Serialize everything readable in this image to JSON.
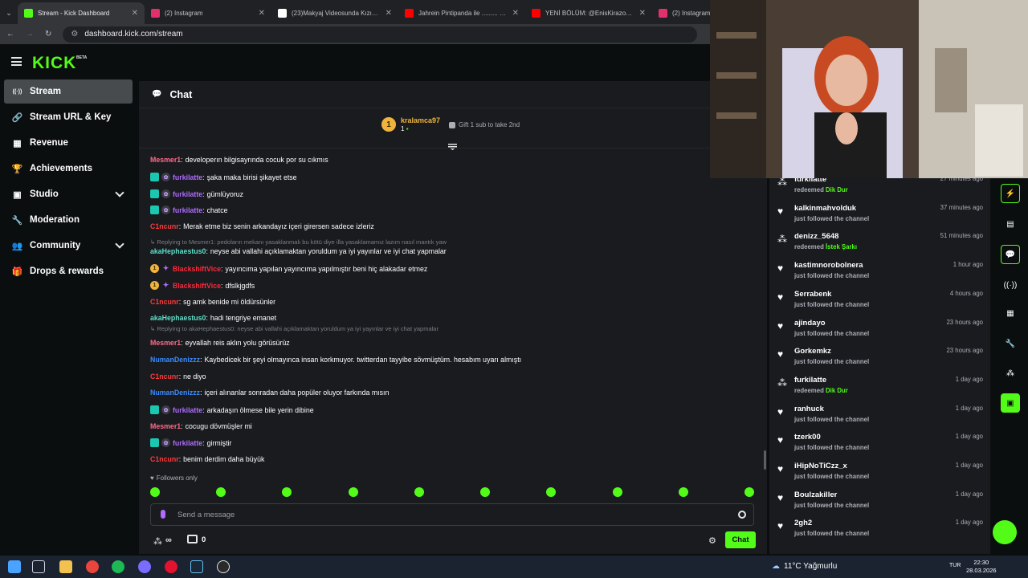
{
  "browser": {
    "tabs": [
      {
        "title": "Stream - Kick Dashboard",
        "icon": "kick-favicon",
        "color": "#53fc18",
        "active": true
      },
      {
        "title": "(2) Instagram",
        "icon": "instagram-favicon",
        "color": "#e1306c"
      },
      {
        "title": "(23)Makyaj Videosunda Kızın İ…",
        "icon": "tiktok-favicon",
        "color": "#ffffff"
      },
      {
        "title": "Jahrein Pintipanda ile ......... #sh",
        "icon": "youtube-favicon",
        "color": "#ff0000"
      },
      {
        "title": "YENİ BÖLÜM: @EnisKirazoglu…",
        "icon": "youtube-favicon",
        "color": "#ff0000"
      },
      {
        "title": "(2) Instagram",
        "icon": "instagram-favicon",
        "color": "#e1306c"
      }
    ],
    "url": "dashboard.kick.com/stream"
  },
  "header": {
    "logo": "KICK",
    "logo_badge": "BETA"
  },
  "sidebar": {
    "items": [
      {
        "label": "Stream",
        "icon": "broadcast-icon",
        "glyph": "((·))",
        "active": true
      },
      {
        "label": "Stream URL & Key",
        "icon": "link-icon",
        "glyph": "🔗"
      },
      {
        "label": "Revenue",
        "icon": "chart-icon",
        "glyph": "▦"
      },
      {
        "label": "Achievements",
        "icon": "trophy-icon",
        "glyph": "🏆"
      },
      {
        "label": "Studio",
        "icon": "tv-icon",
        "glyph": "▣",
        "chevron": true
      },
      {
        "label": "Moderation",
        "icon": "wrench-icon",
        "glyph": "🔧"
      },
      {
        "label": "Community",
        "icon": "users-icon",
        "glyph": "👥",
        "chevron": true
      },
      {
        "label": "Drops & rewards",
        "icon": "gift-icon",
        "glyph": "🎁"
      }
    ]
  },
  "chat": {
    "title": "Chat",
    "pinned": {
      "rank": "1",
      "user": "kralamca97",
      "count": "1",
      "gift_text": "Gift 1 sub to take 2nd"
    },
    "messages": [
      {
        "user": "Mesmer1",
        "color": "#ff6b8a",
        "badges": [],
        "text": "developerın bilgisayrında cocuk por su cıkmıs"
      },
      {
        "user": "furkilatte",
        "color": "#b06cff",
        "badges": [
          "sub",
          "fav"
        ],
        "text": "şaka maka birisi şikayet etse"
      },
      {
        "user": "furkilatte",
        "color": "#b06cff",
        "badges": [
          "sub",
          "fav"
        ],
        "text": "gümlüyoruz"
      },
      {
        "user": "furkilatte",
        "color": "#b06cff",
        "badges": [
          "sub",
          "fav"
        ],
        "text": "chatce"
      },
      {
        "user": "C1ncunr",
        "color": "#ff3b3b",
        "badges": [],
        "text": "Merak etme biz senin arkandayız içeri girersen sadece izleriz"
      },
      {
        "reply": "Replying to Mesmer1: pedoların mekanı yasaklanmalı bu kötü diye illa yasaklamamız lazım nasıl mantık yaw"
      },
      {
        "user": "akaHephaestus0",
        "color": "#5ce0c8",
        "badges": [],
        "text": "neyse abi vallahi açıklamaktan yoruldum ya iyi yayınlar ve iyi chat yapmalar"
      },
      {
        "user": "BlackshiftVice",
        "color": "#ff2a3b",
        "badges": [
          "gold",
          "paw"
        ],
        "text": "yayıncıma yapılan yayıncıma yapılmıştır beni hiç alakadar etmez"
      },
      {
        "user": "BlackshiftVice",
        "color": "#ff2a3b",
        "badges": [
          "gold",
          "paw"
        ],
        "text": "dfslkjgdfs"
      },
      {
        "user": "C1ncunr",
        "color": "#ff3b3b",
        "badges": [],
        "text": "sg amk benide mi öldürsünler"
      },
      {
        "user": "akaHephaestus0",
        "color": "#5ce0c8",
        "badges": [],
        "text": "hadi tengriye emanet"
      },
      {
        "reply": "Replying to akaHephaestus0: neyse abi vallahi açıklamaktan yoruldum ya iyi yayınlar ve iyi chat yapmalar"
      },
      {
        "user": "Mesmer1",
        "color": "#ff6b8a",
        "badges": [],
        "text": "eyvallah reis aklın yolu görüsürüz"
      },
      {
        "user": "NumanDenizzz",
        "color": "#3a8cff",
        "badges": [],
        "text": "Kaybedicek bir şeyi olmayınca insan korkmuyor. twitterdan tayyibe sövmüştüm. hesabım uyarı almıştı"
      },
      {
        "user": "C1ncunr",
        "color": "#ff3b3b",
        "badges": [],
        "text": "ne diyo"
      },
      {
        "user": "NumanDenizzz",
        "color": "#3a8cff",
        "badges": [],
        "text": "içeri alınanlar sonradan daha popüler oluyor farkında mısın"
      },
      {
        "user": "furkilatte",
        "color": "#b06cff",
        "badges": [
          "sub",
          "fav"
        ],
        "text": "arkadaşın ölmese bile yerin dibine"
      },
      {
        "user": "Mesmer1",
        "color": "#ff6b8a",
        "badges": [],
        "text": "cocugu dövmüşler mi"
      },
      {
        "user": "furkilatte",
        "color": "#b06cff",
        "badges": [
          "sub",
          "fav"
        ],
        "text": "girmiştir"
      },
      {
        "user": "C1ncunr",
        "color": "#ff3b3b",
        "badges": [],
        "text": "benim derdim daha büyük"
      }
    ],
    "followers_only": "Followers only",
    "input_placeholder": "Send a message",
    "points": "∞",
    "bag_count": "0",
    "send_label": "Chat"
  },
  "feed": [
    {
      "name": "furkilatte",
      "kind": "redeem",
      "text": "redeemed ",
      "highlight": "Dik Dur",
      "time": "27 minutes ago",
      "icon": "points-icon"
    },
    {
      "name": "kalkinmahvolduk",
      "kind": "follow",
      "text": "just followed the channel",
      "time": "37 minutes ago",
      "icon": "heart-icon"
    },
    {
      "name": "denizz_5648",
      "kind": "redeem",
      "text": "redeemed ",
      "highlight": "İstek Şarkı",
      "time": "51 minutes ago",
      "icon": "points-icon"
    },
    {
      "name": "kastimnorobolnera",
      "kind": "follow",
      "text": "just followed the channel",
      "time": "1 hour ago",
      "icon": "heart-icon"
    },
    {
      "name": "Serrabenk",
      "kind": "follow",
      "text": "just followed the channel",
      "time": "4 hours ago",
      "icon": "heart-icon"
    },
    {
      "name": "ajindayo",
      "kind": "follow",
      "text": "just followed the channel",
      "time": "23 hours ago",
      "icon": "heart-icon"
    },
    {
      "name": "Gorkemkz",
      "kind": "follow",
      "text": "just followed the channel",
      "time": "23 hours ago",
      "icon": "heart-icon"
    },
    {
      "name": "furkilatte",
      "kind": "redeem",
      "text": "redeemed ",
      "highlight": "Dik Dur",
      "time": "1 day ago",
      "icon": "points-icon"
    },
    {
      "name": "ranhuck",
      "kind": "follow",
      "text": "just followed the channel",
      "time": "1 day ago",
      "icon": "heart-icon"
    },
    {
      "name": "tzerk00",
      "kind": "follow",
      "text": "just followed the channel",
      "time": "1 day ago",
      "icon": "heart-icon"
    },
    {
      "name": "iHipNoTiCzz_x",
      "kind": "follow",
      "text": "just followed the channel",
      "time": "1 day ago",
      "icon": "heart-icon"
    },
    {
      "name": "Boulzakiller",
      "kind": "follow",
      "text": "just followed the channel",
      "time": "1 day ago",
      "icon": "heart-icon"
    },
    {
      "name": "2gh2",
      "kind": "follow",
      "text": "just followed the channel",
      "time": "1 day ago",
      "icon": "heart-icon"
    }
  ],
  "taskbar": {
    "weather": "11°C  Yağmurlu",
    "lang": "TUR",
    "time": "22:30",
    "date": "28.03.2026"
  }
}
